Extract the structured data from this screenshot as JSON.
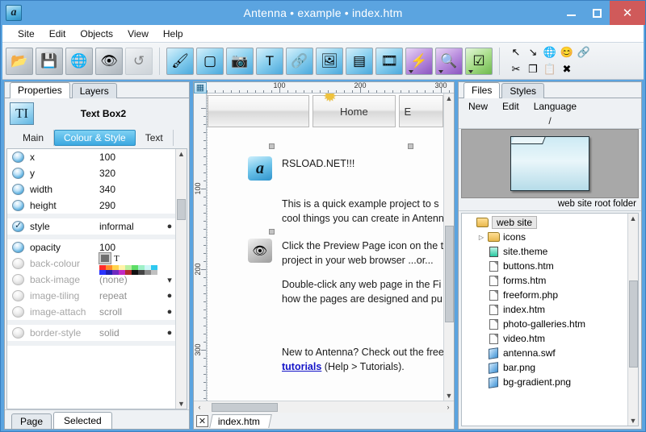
{
  "window": {
    "title": "Antenna • example • index.htm",
    "app_icon": "a",
    "minimize": "–",
    "maximize": "□",
    "close": "✕"
  },
  "menubar": {
    "items": [
      "Site",
      "Edit",
      "Objects",
      "View",
      "Help"
    ]
  },
  "toolbar": {
    "group1": [
      {
        "name": "open-site-icon",
        "glyph": "📂",
        "style": "grey"
      },
      {
        "name": "save-icon",
        "glyph": "💾",
        "style": "grey"
      },
      {
        "name": "publish-icon",
        "glyph": "🌐",
        "style": "grey"
      },
      {
        "name": "preview-page-icon",
        "glyph": "👁",
        "style": "grey"
      },
      {
        "name": "undo-icon",
        "glyph": "↺",
        "style": "grey disabled"
      }
    ],
    "group2": [
      {
        "name": "paint-style-icon",
        "glyph": "🖌",
        "style": "blue"
      },
      {
        "name": "rectangle-icon",
        "glyph": "▢",
        "style": "blue"
      },
      {
        "name": "photo-icon",
        "glyph": "📷",
        "style": "blue"
      },
      {
        "name": "text-box-icon",
        "glyph": "T",
        "style": "blue"
      },
      {
        "name": "link-icon",
        "glyph": "🔗",
        "style": "blue"
      },
      {
        "name": "gallery-icon",
        "glyph": "🖼",
        "style": "blue"
      },
      {
        "name": "menu-bar-icon",
        "glyph": "▤",
        "style": "blue"
      },
      {
        "name": "slideshow-icon",
        "glyph": "🎞",
        "style": "blue"
      },
      {
        "name": "effects-icon",
        "glyph": "⚡",
        "style": "purple"
      },
      {
        "name": "zoom-icon",
        "glyph": "🔍",
        "style": "purple"
      },
      {
        "name": "form-icon",
        "glyph": "☑",
        "style": "green"
      }
    ],
    "mini_icons": [
      {
        "name": "select-arrow-icon",
        "glyph": "↖"
      },
      {
        "name": "send-down-icon",
        "glyph": "↘"
      },
      {
        "name": "globe-select-icon",
        "glyph": "🌐"
      },
      {
        "name": "smiley-icon",
        "glyph": "😊"
      },
      {
        "name": "chain-icon",
        "glyph": "🔗"
      },
      {
        "name": "cut-icon",
        "glyph": "✂"
      },
      {
        "name": "copy-icon",
        "glyph": "❐"
      },
      {
        "name": "paste-icon",
        "glyph": "📋"
      },
      {
        "name": "delete-icon",
        "glyph": "✖"
      }
    ]
  },
  "left_panel": {
    "tabs": [
      {
        "label": "Properties",
        "active": true
      },
      {
        "label": "Layers",
        "active": false
      }
    ],
    "object_name": "Text Box2",
    "object_icon": "TI",
    "subtabs": [
      {
        "label": "Main",
        "active": false
      },
      {
        "label": "Colour & Style",
        "active": true
      },
      {
        "label": "Text",
        "active": false
      }
    ],
    "property_groups": [
      {
        "rows": [
          {
            "label": "x",
            "value": "100",
            "state": "on",
            "dim": false,
            "dot": ""
          },
          {
            "label": "y",
            "value": "320",
            "state": "on",
            "dim": false,
            "dot": ""
          },
          {
            "label": "width",
            "value": "340",
            "state": "on",
            "dim": false,
            "dot": ""
          },
          {
            "label": "height",
            "value": "290",
            "state": "on",
            "dim": false,
            "dot": ""
          }
        ]
      },
      {
        "rows": [
          {
            "label": "style",
            "value": "informal",
            "state": "check",
            "dim": false,
            "dot": "●"
          }
        ]
      },
      {
        "rows": [
          {
            "label": "opacity",
            "value": "100",
            "state": "on",
            "dim": false,
            "dot": ""
          },
          {
            "label": "back-colour",
            "value": "",
            "state": "off",
            "dim": true,
            "dot": "",
            "kind": "palette"
          },
          {
            "label": "back-image",
            "value": "(none)",
            "state": "off",
            "dim": true,
            "dot": "▾",
            "kind": "picker"
          },
          {
            "label": "image-tiling",
            "value": "repeat",
            "state": "off",
            "dim": true,
            "dot": "●"
          },
          {
            "label": "image-attach",
            "value": "scroll",
            "state": "off",
            "dim": true,
            "dot": "●"
          }
        ]
      },
      {
        "rows": [
          {
            "label": "border-style",
            "value": "solid",
            "state": "off",
            "dim": true,
            "dot": "●"
          }
        ]
      }
    ],
    "palette_colors": [
      "#ff2a2a",
      "#ff8a2a",
      "#ffd34d",
      "#fff3a8",
      "#b9f0a0",
      "#5ddd66",
      "#9ff0c8",
      "#cdf7f7",
      "#2ec8f0",
      "#ffffff",
      "#2a33ff",
      "#1f1fb0",
      "#6e2abf",
      "#c22ac2",
      "#b02a2a",
      "#111111",
      "#444444",
      "#8a8a8a",
      "#c0c0c0",
      "#ffffff"
    ],
    "bottom_tabs": [
      {
        "label": "Page",
        "active": false
      },
      {
        "label": "Selected",
        "active": true
      }
    ]
  },
  "center": {
    "grid_icon": "▦",
    "h_ruler_labels": [
      "100",
      "200",
      "300"
    ],
    "v_ruler_labels": [
      "100",
      "200",
      "300"
    ],
    "page_buttons": [
      {
        "label": ""
      },
      {
        "label": "Home"
      },
      {
        "label": "E"
      }
    ],
    "blocks": [
      {
        "icon_name": "antenna-logo-icon",
        "icon_glyph": "a",
        "icon_type": "a",
        "lines": [
          "RSLOAD.NET!!!"
        ]
      },
      {
        "icon_name": "",
        "icon_glyph": "",
        "icon_type": "none",
        "lines": [
          "This is a quick example project to s",
          "cool things you can create in Antenn"
        ]
      },
      {
        "icon_name": "preview-eye-icon",
        "icon_glyph": "👁",
        "icon_type": "eye",
        "lines": [
          "Click the Preview Page icon on the to",
          "project in your web browser ...or..."
        ]
      },
      {
        "icon_name": "",
        "icon_glyph": "",
        "icon_type": "none",
        "lines": [
          "Double-click any web page in the Fi",
          "how the pages are designed and pu"
        ]
      }
    ],
    "footer_text_before": "New to Antenna?  Check out the free",
    "footer_link": "tutorials",
    "footer_text_after": " (Help > Tutorials).",
    "scroll_left": "‹",
    "scroll_right": "›",
    "doc_close": "✕",
    "doc_tab": "index.htm"
  },
  "right_panel": {
    "tabs": [
      {
        "label": "Files",
        "active": true
      },
      {
        "label": "Styles",
        "active": false
      }
    ],
    "menu": [
      "New",
      "Edit",
      "Language"
    ],
    "path": "/",
    "preview_label": "web site root folder",
    "files": [
      {
        "name": "web site",
        "icon": "folder",
        "indent": 0,
        "selected": true,
        "twisty": ""
      },
      {
        "name": "icons",
        "icon": "folder",
        "indent": 1,
        "selected": false,
        "twisty": "▷"
      },
      {
        "name": "site.theme",
        "icon": "theme",
        "indent": 1,
        "selected": false,
        "twisty": ""
      },
      {
        "name": "buttons.htm",
        "icon": "doc",
        "indent": 1,
        "selected": false,
        "twisty": ""
      },
      {
        "name": "forms.htm",
        "icon": "doc",
        "indent": 1,
        "selected": false,
        "twisty": ""
      },
      {
        "name": "freeform.php",
        "icon": "doc",
        "indent": 1,
        "selected": false,
        "twisty": ""
      },
      {
        "name": "index.htm",
        "icon": "doc",
        "indent": 1,
        "selected": false,
        "twisty": ""
      },
      {
        "name": "photo-galleries.htm",
        "icon": "doc",
        "indent": 1,
        "selected": false,
        "twisty": ""
      },
      {
        "name": "video.htm",
        "icon": "doc",
        "indent": 1,
        "selected": false,
        "twisty": ""
      },
      {
        "name": "antenna.swf",
        "icon": "media",
        "indent": 1,
        "selected": false,
        "twisty": ""
      },
      {
        "name": "bar.png",
        "icon": "media",
        "indent": 1,
        "selected": false,
        "twisty": ""
      },
      {
        "name": "bg-gradient.png",
        "icon": "media",
        "indent": 1,
        "selected": false,
        "twisty": ""
      }
    ]
  },
  "colors": {
    "titlebar": "#5ba4e0",
    "close_button": "#d05a5a",
    "accent": "#3aa8e0",
    "link": "#1414c8"
  }
}
